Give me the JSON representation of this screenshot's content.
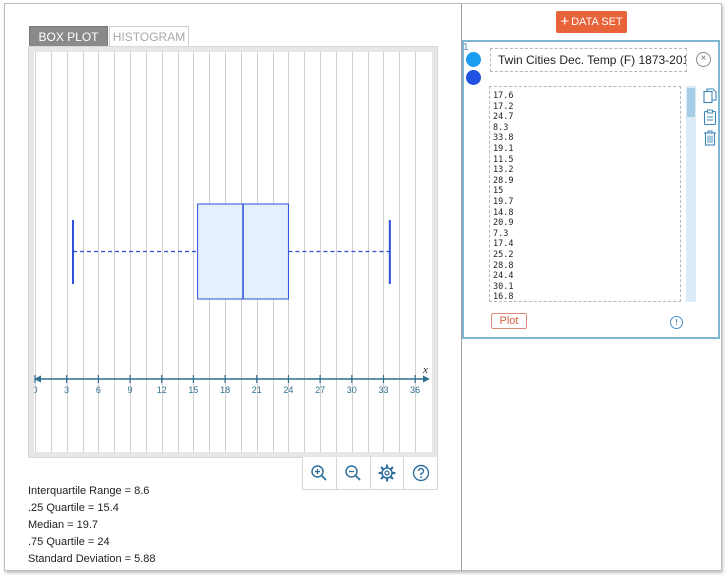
{
  "tabs": [
    {
      "label": "BOX PLOT",
      "active": true
    },
    {
      "label": "HISTOGRAM",
      "active": false
    }
  ],
  "chart_data": {
    "type": "boxplot",
    "xlabel": "x",
    "xlim": [
      0,
      37
    ],
    "ticks": [
      0,
      3,
      6,
      9,
      12,
      15,
      18,
      21,
      24,
      27,
      30,
      33,
      36
    ],
    "tick_labels": [
      "0",
      "3",
      "6",
      "9",
      "12",
      "15",
      "18",
      "21",
      "24",
      "27",
      "30",
      "33",
      "36"
    ],
    "min": 3.6,
    "q1": 15.4,
    "median": 19.7,
    "q3": 24,
    "max": 33.6,
    "box_color": "#2c4fd8",
    "box_fill": "#e4f0fb",
    "axis_color": "#2f6f8f"
  },
  "toolbar": {
    "zoom_in_icon": "zoom-in-icon",
    "zoom_out_icon": "zoom-out-icon",
    "settings_icon": "gear-icon",
    "help_icon": "help-icon"
  },
  "stats": {
    "iqr": "Interquartile Range = 8.6",
    "q1": ".25 Quartile = 15.4",
    "median": "Median = 19.7",
    "q3": ".75 Quartile = 24",
    "sd": "Standard Deviation = 5.88"
  },
  "right_panel": {
    "add_button": "DATA SET",
    "dataset_number": "1",
    "dataset_name": "Twin Cities Dec. Temp (F) 1873-201",
    "close_label": "×",
    "data_values": [
      "17.6",
      "17.2",
      "24.7",
      "8.3",
      "33.8",
      "19.1",
      "11.5",
      "13.2",
      "28.9",
      "15",
      "19.7",
      "14.8",
      "20.9",
      "7.3",
      "17.4",
      "25.2",
      "28.8",
      "24.4",
      "30.1",
      "16.8"
    ],
    "plot_button": "Plot",
    "info_label": "!",
    "accent": "#e8623a",
    "dot_colors": [
      "#1a9cf0",
      "#2253e0"
    ]
  }
}
